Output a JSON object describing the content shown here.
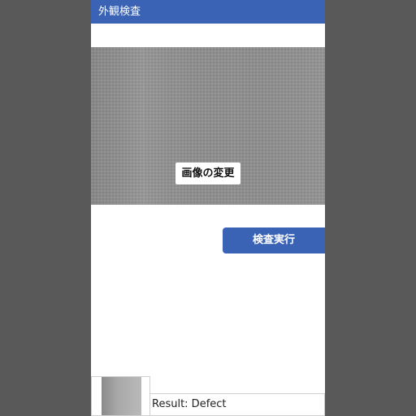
{
  "app": {
    "title": "外観検査"
  },
  "image_panel": {
    "change_image_label": "画像の変更",
    "fill_color": "#8f8f8f"
  },
  "actions": {
    "run_inspection_label": "検査実行"
  },
  "result": {
    "text": "Result: Defect"
  },
  "colors": {
    "accent": "#3a63b5",
    "background": "#595959",
    "surface": "#ffffff"
  }
}
